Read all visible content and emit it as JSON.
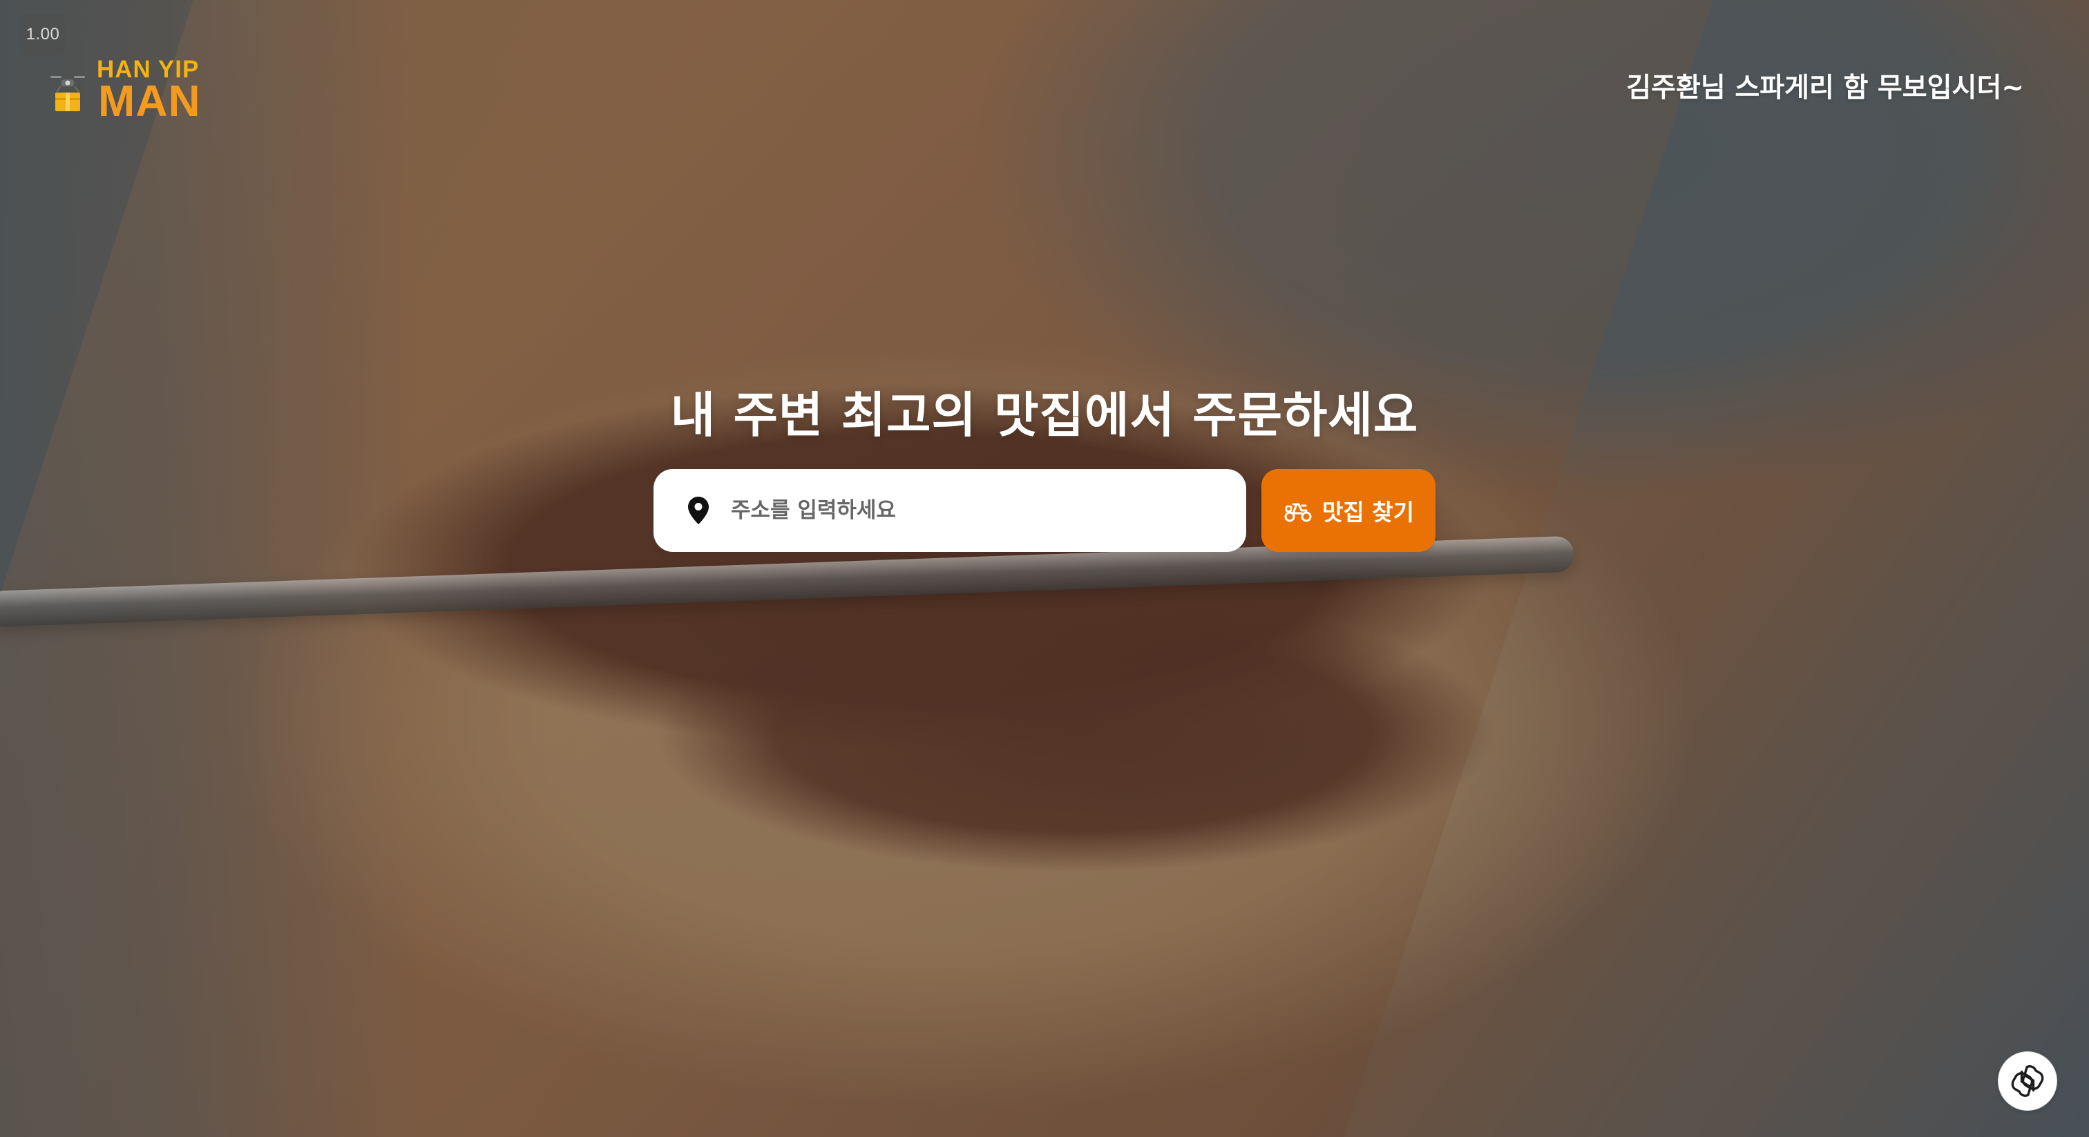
{
  "app": {
    "zoom_label": "1.00",
    "logo": {
      "top_text": "HAN YIP",
      "bottom_text": "MAN",
      "icon": "drone-package-icon"
    },
    "greeting": "김주환님 스파게리 함 무보입시더~",
    "hero_title": "내 주변 최고의 맛집에서 주문하세요",
    "search": {
      "placeholder": "주소를 입력하세요",
      "value": "",
      "location_icon": "location-pin-icon",
      "button_label": "맛집 찾기",
      "button_icon": "scooter-icon"
    },
    "assistant_icon": "openai-logo-icon",
    "colors": {
      "accent": "#ea7205",
      "logo_yellow": "#f4b313",
      "logo_orange": "#f29b1f",
      "text_light": "#ffffff"
    }
  }
}
